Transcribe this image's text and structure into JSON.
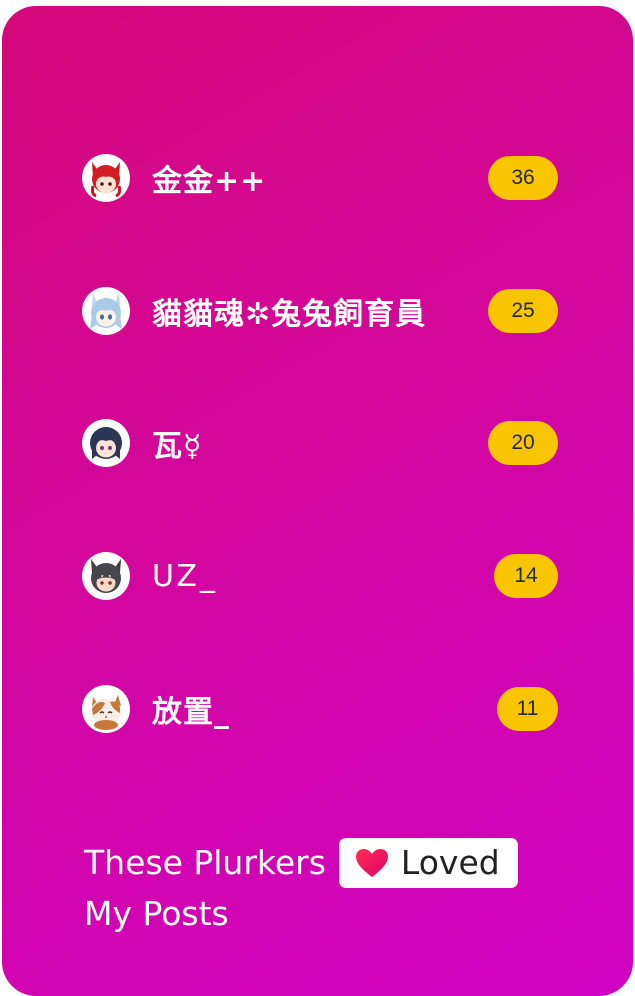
{
  "plurkers": [
    {
      "name": "金金++",
      "count": "36",
      "avatar": "red-hair-girl-avatar"
    },
    {
      "name": "貓貓魂✲兔兔飼育員",
      "count": "25",
      "avatar": "blue-hair-girl-avatar"
    },
    {
      "name": "瓦☿",
      "count": "20",
      "avatar": "dark-hair-girl-avatar"
    },
    {
      "name": "UZ_",
      "count": "14",
      "avatar": "gray-wolf-boy-avatar"
    },
    {
      "name": "放置_",
      "count": "11",
      "avatar": "calico-cat-avatar"
    }
  ],
  "caption": {
    "prefix": "These Plurkers",
    "loved_label": "Loved",
    "suffix": "My Posts",
    "loved_icon": "heart-icon"
  },
  "colors": {
    "card_gradient_start": "#d4087a",
    "card_gradient_end": "#cf02c2",
    "count_badge": "#f8c500",
    "text": "#ffffff"
  }
}
